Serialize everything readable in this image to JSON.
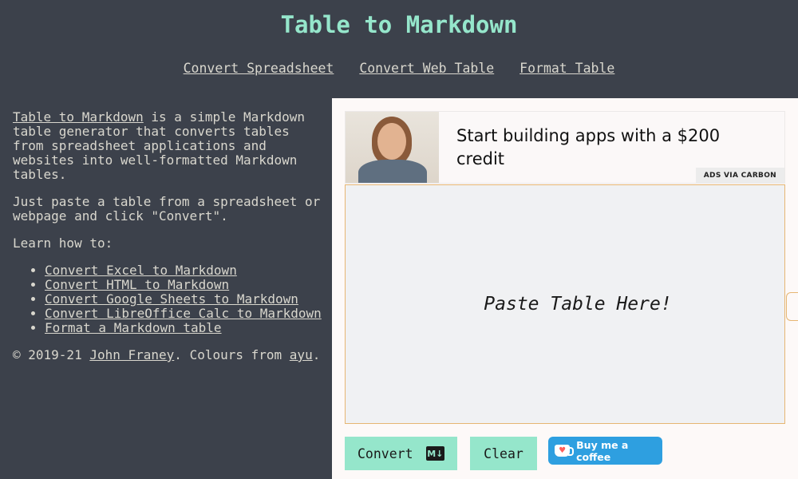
{
  "header": {
    "title": "Table to Markdown",
    "nav": [
      {
        "label": "Convert Spreadsheet"
      },
      {
        "label": "Convert Web Table"
      },
      {
        "label": "Format Table"
      }
    ]
  },
  "sidebar": {
    "intro_link": "Table to Markdown",
    "intro_text": " is a simple Markdown table generator that converts tables from spreadsheet applications and websites into well-formatted Markdown tables.",
    "instructions": "Just paste a table from a spreadsheet or webpage and click \"Convert\".",
    "learn_heading": "Learn how to:",
    "learn_links": [
      {
        "label": "Convert Excel to Markdown"
      },
      {
        "label": "Convert HTML to Markdown"
      },
      {
        "label": "Convert Google Sheets to Markdown"
      },
      {
        "label": "Convert LibreOffice Calc to Markdown"
      },
      {
        "label": "Format a Markdown table"
      }
    ],
    "footer": {
      "copyright": "© 2019-21 ",
      "author": "John Franey",
      "colours_text": ". Colours from ",
      "colours_link": "ayu",
      "end": "."
    }
  },
  "ad": {
    "text": "Start building apps with a $200 credit",
    "badge": "ADS VIA CARBON"
  },
  "editor": {
    "placeholder": "Paste Table Here!"
  },
  "actions": {
    "convert_label": "Convert",
    "convert_icon": "M↓",
    "clear_label": "Clear",
    "coffee_label": "Buy me a coffee"
  },
  "colors": {
    "background": "#3c414b",
    "accent": "#95e6cb",
    "text": "#d9d7ce",
    "editor_border": "#e6b673",
    "coffee": "#2e9fe0"
  }
}
